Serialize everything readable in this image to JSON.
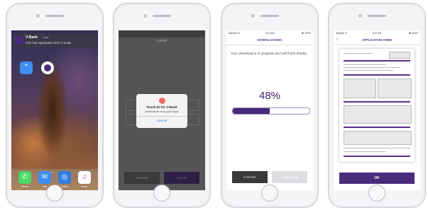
{
  "colors": {
    "brand": "#4a2a7c",
    "brand_text": "#5b2d8c",
    "dialog_link": "#2c6fd6",
    "touch_icon": "#f26a6a"
  },
  "screen1": {
    "notification": {
      "app": "V-Bank",
      "time": "now",
      "body": "Your loan application form is ready"
    },
    "dock_labels": [
      "Phone",
      "Mail",
      "Safari",
      "Music"
    ],
    "icons": [
      "phone-icon",
      "mail-icon",
      "safari-icon",
      "music-icon",
      "app-store-icon",
      "v-bank-icon"
    ]
  },
  "screen2": {
    "header": "LOGIN",
    "dialog": {
      "title": "Touch ID for V-Bank",
      "subtitle": "Authenticate using your finger",
      "cancel": "Cancel"
    },
    "cancel_button": "CANCEL",
    "login_button": "LOGIN"
  },
  "screen3": {
    "status_left": "Sample ≋",
    "status_time": "9:41 AM",
    "status_right": "✱ 100%",
    "title": "DOWNLOADING",
    "message": "Your download is in progress and will finish shortly.",
    "percent_label": "48%",
    "progress_fraction": 0.48,
    "cancel_button": "CANCEL",
    "continue_button": "CONTINUE"
  },
  "screen4": {
    "status_left": "Sample ≋",
    "status_time": "9:41 AM",
    "status_right": "✱ 100%",
    "back": "‹",
    "title": "APPLICATION FORM",
    "ok_button": "OK"
  }
}
